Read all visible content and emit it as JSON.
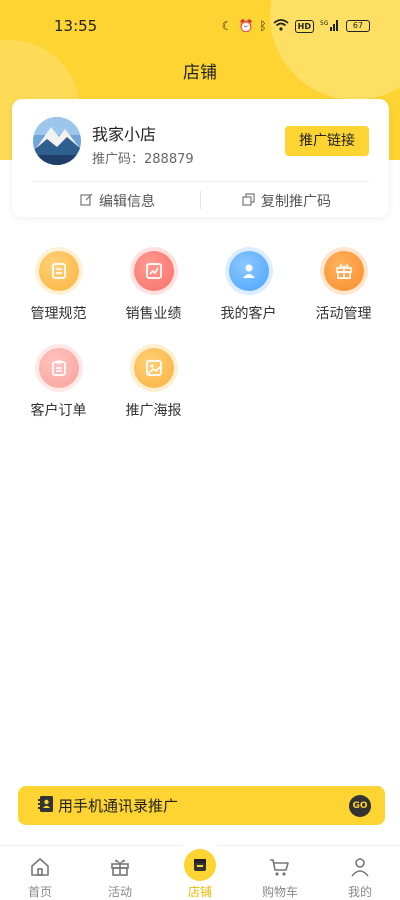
{
  "status_bar": {
    "time": "13:55",
    "network": "5G",
    "battery": "67"
  },
  "header": {
    "title": "店铺"
  },
  "shop_card": {
    "shop_name": "我家小店",
    "promo_code_label": "推广码：",
    "promo_code": "288879",
    "promo_link_button": "推广链接",
    "edit_info": "编辑信息",
    "copy_promo_code": "复制推广码"
  },
  "grid_items": [
    {
      "label": "管理规范",
      "icon": "document-icon",
      "color": "#fcb23b"
    },
    {
      "label": "销售业绩",
      "icon": "trend-chart-icon",
      "color": "#f7706a"
    },
    {
      "label": "我的客户",
      "icon": "person-icon",
      "color": "#4aa3ff"
    },
    {
      "label": "活动管理",
      "icon": "gift-icon",
      "color": "#fb8c2b"
    },
    {
      "label": "客户订单",
      "icon": "clipboard-icon",
      "color": "#f9a09a"
    },
    {
      "label": "推广海报",
      "icon": "image-icon",
      "color": "#f9b13a"
    }
  ],
  "phone_promo": {
    "label": "用手机通讯录推广",
    "go_label": "GO"
  },
  "tabbar": {
    "items": [
      {
        "label": "首页",
        "icon": "home-icon"
      },
      {
        "label": "活动",
        "icon": "gift-icon"
      },
      {
        "label": "店铺",
        "icon": "store-icon"
      },
      {
        "label": "购物车",
        "icon": "cart-icon"
      },
      {
        "label": "我的",
        "icon": "user-icon"
      }
    ],
    "active_index": 2
  },
  "colors": {
    "accent": "#fdd431",
    "active_tab": "#f1b800"
  }
}
